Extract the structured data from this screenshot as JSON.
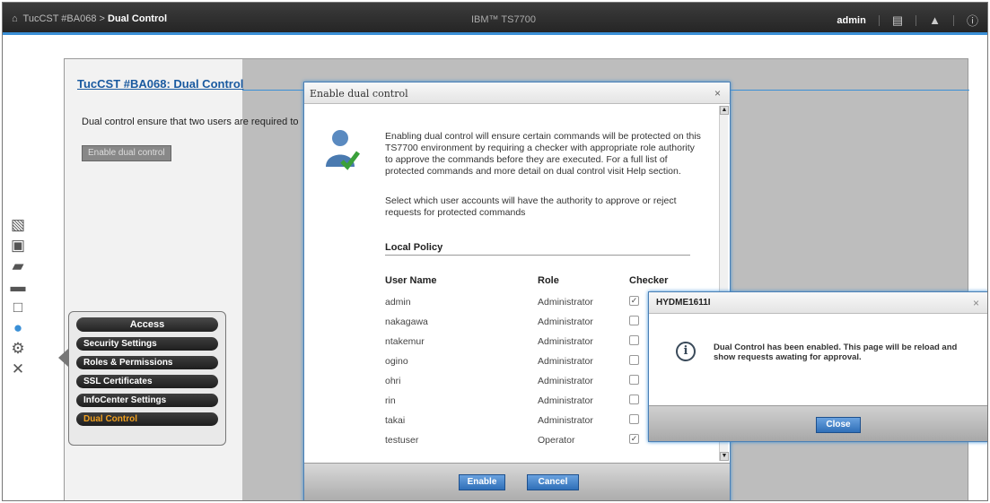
{
  "topbar": {
    "breadcrumb_system": "TucCST #BA068",
    "breadcrumb_separator": ">",
    "breadcrumb_current": "Dual Control",
    "product": "IBM™ TS7700",
    "user": "admin"
  },
  "page": {
    "title": "TucCST #BA068: Dual Control",
    "description": "Dual control ensure that two users are required to",
    "enable_button": "Enable dual control"
  },
  "access_menu": {
    "title": "Access",
    "items": [
      {
        "label": "Security Settings"
      },
      {
        "label": "Roles & Permissions"
      },
      {
        "label": "SSL Certificates"
      },
      {
        "label": "InfoCenter Settings"
      },
      {
        "label": "Dual Control"
      }
    ]
  },
  "dialog": {
    "title": "Enable dual control",
    "close": "×",
    "intro": "Enabling dual control will ensure certain commands will be protected on this TS7700 environment by requiring a checker with appropriate role authority to approve the commands before they are executed. For a full list of protected commands and more detail on dual control visit Help section.",
    "select_text": "Select which user accounts will have the authority to approve or reject requests for protected commands",
    "policy_title": "Local Policy",
    "columns": {
      "user": "User Name",
      "role": "Role",
      "checker": "Checker"
    },
    "users": [
      {
        "name": "admin",
        "role": "Administrator",
        "checked": true
      },
      {
        "name": "nakagawa",
        "role": "Administrator",
        "checked": false
      },
      {
        "name": "ntakemur",
        "role": "Administrator",
        "checked": false
      },
      {
        "name": "ogino",
        "role": "Administrator",
        "checked": false
      },
      {
        "name": "ohri",
        "role": "Administrator",
        "checked": false
      },
      {
        "name": "rin",
        "role": "Administrator",
        "checked": false
      },
      {
        "name": "takai",
        "role": "Administrator",
        "checked": false
      },
      {
        "name": "testuser",
        "role": "Operator",
        "checked": true
      }
    ],
    "enable_button": "Enable",
    "cancel_button": "Cancel"
  },
  "message": {
    "title": "HYDME1611I",
    "close": "×",
    "text": "Dual Control has been enabled. This page will be reload and show requests awating for approval.",
    "close_button": "Close"
  }
}
